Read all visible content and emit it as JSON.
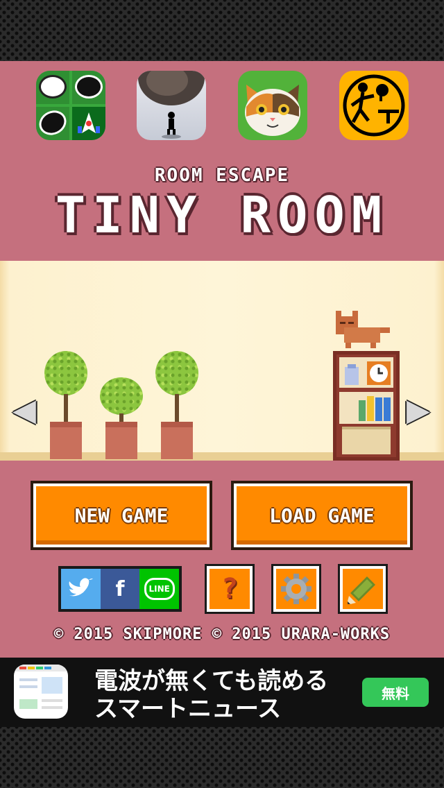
{
  "header": {
    "subtitle": "ROOM ESCAPE",
    "title": "TINY ROOM"
  },
  "promo_apps": [
    {
      "icon": "reversi-app-icon"
    },
    {
      "icon": "dark-sphere-app-icon"
    },
    {
      "icon": "cat-face-app-icon"
    },
    {
      "icon": "table-tennis-app-icon"
    }
  ],
  "room": {
    "left_arrow": "◀",
    "right_arrow": "▶"
  },
  "buttons": {
    "new_game": "NEW GAME",
    "load_game": "LOAD GAME",
    "help": "?"
  },
  "social": {
    "facebook": "f",
    "line": "LINE"
  },
  "copyright": "© 2015 SKIPMORE © 2015 URARA-WORKS",
  "ad": {
    "line1": "電波が無くても読める",
    "line2": "スマートニュース",
    "cta": "無料"
  },
  "colors": {
    "pink": "#c5707e",
    "orange": "#ff8a00",
    "cream": "#fef5d8"
  }
}
